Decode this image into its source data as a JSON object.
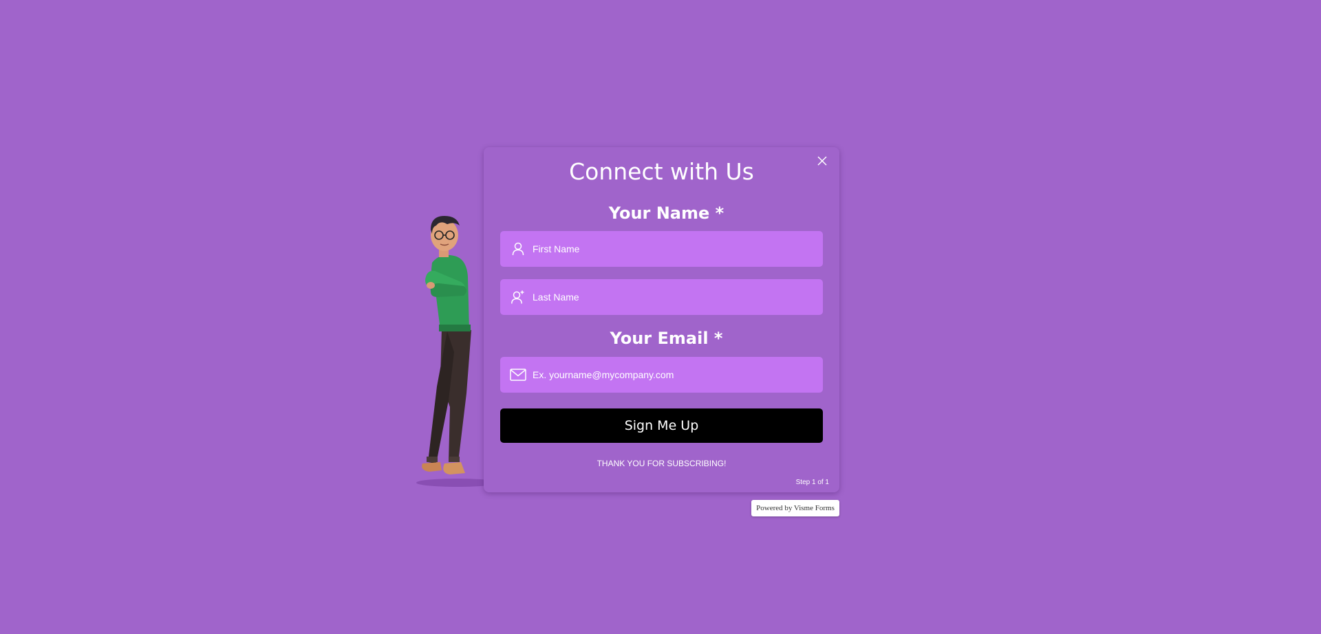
{
  "colors": {
    "background": "#a064cb",
    "field_bg": "#c374f2",
    "button_bg": "#000000",
    "text": "#ffffff"
  },
  "form": {
    "title": "Connect with Us",
    "close_icon": "close-icon",
    "name_label": "Your Name *",
    "first_name": {
      "value": "",
      "placeholder": "First Name",
      "icon": "user-icon"
    },
    "last_name": {
      "value": "",
      "placeholder": "Last Name",
      "icon": "user-plus-icon"
    },
    "email_label": "Your Email *",
    "email": {
      "value": "",
      "placeholder": "Ex. yourname@mycompany.com",
      "icon": "envelope-icon"
    },
    "submit_label": "Sign Me Up",
    "thanks_text": "THANK YOU FOR SUBSCRIBING!",
    "step_text": "Step 1 of 1"
  },
  "footer": {
    "powered_by": "Powered by Visme Forms"
  },
  "illustration": {
    "name": "3d-character-arms-crossed"
  }
}
